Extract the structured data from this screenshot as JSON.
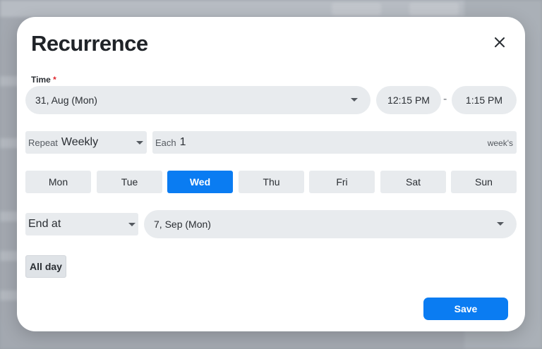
{
  "dialog": {
    "title": "Recurrence",
    "close_icon": "close-icon"
  },
  "time": {
    "label": "Time",
    "required_mark": "*",
    "date": "31, Aug (Mon)",
    "from": "12:15 PM",
    "separator": "-",
    "to": "1:15 PM"
  },
  "repeat": {
    "label": "Repeat",
    "value": "Weekly"
  },
  "each": {
    "label": "Each",
    "value": "1",
    "unit": "week's"
  },
  "days": [
    {
      "label": "Mon",
      "active": false
    },
    {
      "label": "Tue",
      "active": false
    },
    {
      "label": "Wed",
      "active": true
    },
    {
      "label": "Thu",
      "active": false
    },
    {
      "label": "Fri",
      "active": false
    },
    {
      "label": "Sat",
      "active": false
    },
    {
      "label": "Sun",
      "active": false
    }
  ],
  "end": {
    "mode": "End at",
    "date": "7, Sep (Mon)"
  },
  "all_day_label": "All day",
  "save_label": "Save",
  "colors": {
    "accent": "#0a7cf2",
    "required": "#e0262d",
    "field_bg": "#e8ebee"
  }
}
